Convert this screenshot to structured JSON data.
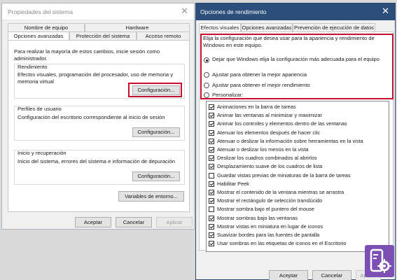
{
  "system_window": {
    "title": "Propiedades del sistema",
    "close_glyph": "✕",
    "tabs_row1": [
      "Nombre de equipo",
      "Hardware"
    ],
    "tabs_row2": [
      "Opciones avanzadas",
      "Protección del sistema",
      "Acceso remoto"
    ],
    "admin_note": "Para realizar la mayoría de estos cambios, inicie sesión como administrador.",
    "performance": {
      "label": "Rendimiento",
      "description": "Efectos visuales, programación del procesador, uso de memoria y memoria virtual",
      "button": "Configuración..."
    },
    "profiles": {
      "label": "Perfiles de usuario",
      "description": "Configuración del escritorio correspondiente al inicio de sesión",
      "button": "Configuración..."
    },
    "startup": {
      "label": "Inicio y recuperación",
      "description": "Inicio del sistema, errores del sistema e información de depuración",
      "button": "Configuración..."
    },
    "env_button": "Variables de entorno...",
    "footer": {
      "ok": "Aceptar",
      "cancel": "Cancelar",
      "apply": "Aplicar"
    }
  },
  "performance_window": {
    "title": "Opciones de rendimiento",
    "close_glyph": "✕",
    "tabs": [
      "Efectos visuales",
      "Opciones avanzadas",
      "Prevención de ejecución de datos"
    ],
    "intro": "Elija la configuración que desea usar para la apariencia y rendimiento de Windows en este equipo.",
    "radios": [
      {
        "label": "Dejar que Windows elija la configuración más adecuada para el equipo",
        "checked": true
      },
      {
        "label": "Ajustar para obtener la mejor apariencia",
        "checked": false
      },
      {
        "label": "Ajustar para obtener el mejor rendimiento",
        "checked": false
      },
      {
        "label": "Personalizar:",
        "checked": false
      }
    ],
    "effects": [
      {
        "label": "Animaciones en la barra de tareas",
        "checked": true
      },
      {
        "label": "Animar las ventanas al minimizar y maximizar",
        "checked": true
      },
      {
        "label": "Animar los controles y elementos dentro de las ventanas",
        "checked": true
      },
      {
        "label": "Atenuar los elementos después de hacer clic",
        "checked": true
      },
      {
        "label": "Atenuar o deslizar la información sobre herramientas en la vista",
        "checked": true
      },
      {
        "label": "Atenuar o deslizar los menús en la vista",
        "checked": true
      },
      {
        "label": "Deslizar los cuadros combinados al abrirlos",
        "checked": true
      },
      {
        "label": "Desplazamiento suave de los cuadros de lista",
        "checked": true
      },
      {
        "label": "Guardar vistas previas de miniaturas de la barra de tareas",
        "checked": false
      },
      {
        "label": "Habilitar Peek",
        "checked": true
      },
      {
        "label": "Mostrar el contenido de la ventana mientras se arrastra",
        "checked": true
      },
      {
        "label": "Mostrar el rectángulo de selección translúcido",
        "checked": true
      },
      {
        "label": "Mostrar sombra bajo el puntero del mouse",
        "checked": false
      },
      {
        "label": "Mostrar sombras bajo las ventanas",
        "checked": true
      },
      {
        "label": "Mostrar vistas en miniatura en lugar de iconos",
        "checked": true
      },
      {
        "label": "Suavizar bordes para las fuentes de pantalla",
        "checked": true
      },
      {
        "label": "Usar sombras en las etiquetas de iconos en el Escritorio",
        "checked": true
      }
    ],
    "footer": {
      "ok": "Aceptar",
      "cancel": "Cancelar",
      "apply": "Aplicar"
    }
  },
  "colors": {
    "highlight": "#c8102e",
    "title_bar_active": "#2b4e7a",
    "logo": "#7b4fb3"
  },
  "logo_icon": "gear-phone-logo-icon"
}
